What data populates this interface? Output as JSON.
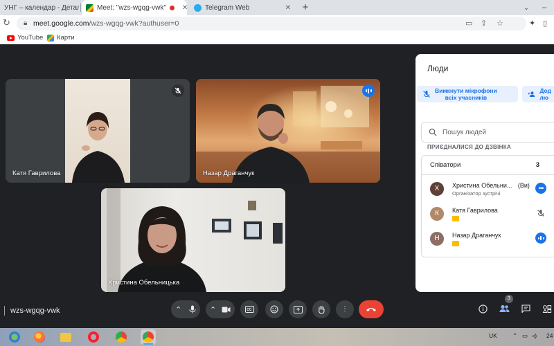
{
  "browser": {
    "tabs": [
      {
        "title": "УНГ – календар - Деталі по",
        "active": false
      },
      {
        "title": "Meet: \"wzs-wgqg-vwk\"",
        "active": true
      },
      {
        "title": "Telegram Web",
        "active": false
      }
    ],
    "new_tab": "+",
    "url": {
      "host": "meet.google.com",
      "path": "/wzs-wgqg-vwk?authuser=0"
    },
    "bookmarks": [
      {
        "label": "YouTube"
      },
      {
        "label": "Карти"
      }
    ]
  },
  "meet": {
    "meeting_code": "wzs-wgqg-vwk",
    "tiles": [
      {
        "name": "Катя Гаврилова",
        "muted": true
      },
      {
        "name": "Назар Драганчук",
        "speaking": true
      },
      {
        "name": "Христина Обельницька"
      }
    ]
  },
  "people_panel": {
    "title": "Люди",
    "mute_all_label_line1": "Вимкнути мікрофони",
    "mute_all_label_line2": "всіх учасників",
    "add_label_line1": "Дод",
    "add_label_line2": "лю",
    "search_placeholder": "Пошук людей",
    "section_label": "ПРИЄДНАЛИСЯ ДО ДЗВІНКА",
    "group_name": "Співатори",
    "group_count": "3",
    "participants": [
      {
        "name": "Христина Обельни...",
        "you_label": "(Ви)",
        "role": "Організатор зустрічі",
        "initial": "Х",
        "avatar_color": "#5d4037"
      },
      {
        "name": "Катя Гаврилова",
        "initial": "К",
        "avatar_color": "#b08968"
      },
      {
        "name": "Назар Драганчук",
        "initial": "Н",
        "avatar_color": "#8d6e63"
      }
    ]
  },
  "controls": {
    "people_count": "3"
  },
  "taskbar": {
    "lang": "UK",
    "time": "24"
  },
  "colors": {
    "meet_bg": "#202124",
    "accent": "#1a73e8",
    "end_call": "#ea4335"
  }
}
